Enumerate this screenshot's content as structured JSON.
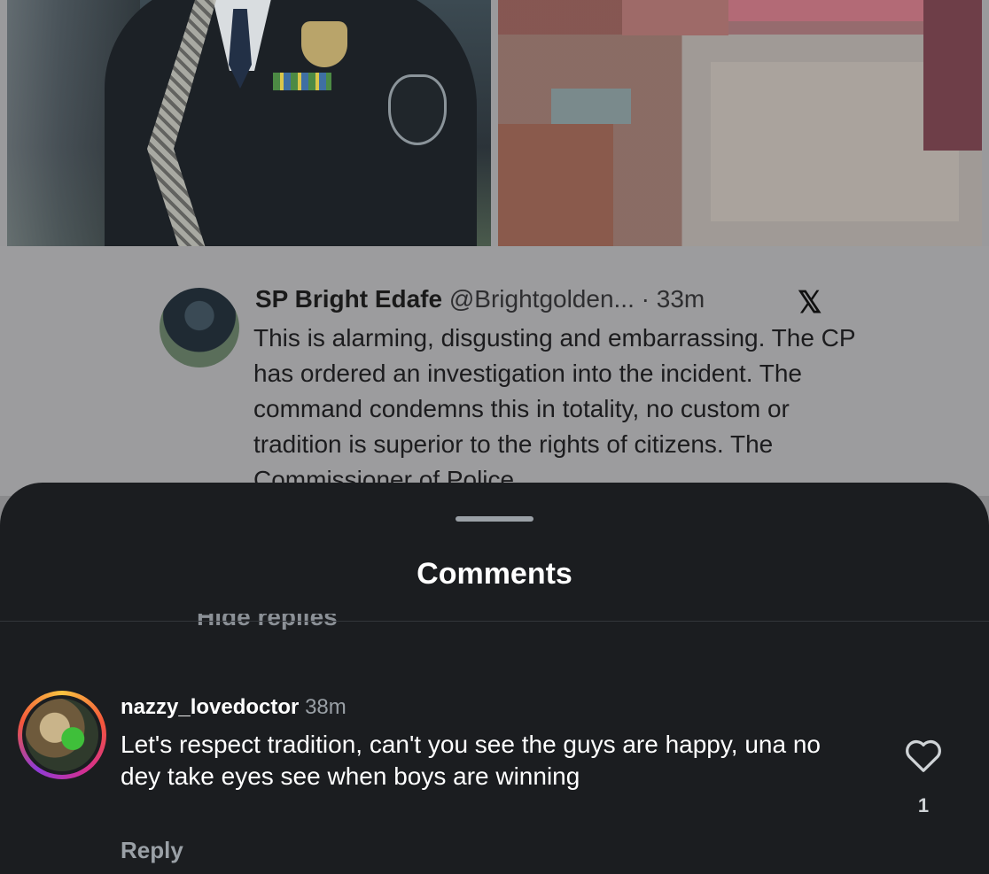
{
  "tweet": {
    "name": "SP Bright Edafe",
    "handle": "@Brightgolden...",
    "separator": " · ",
    "time": "33m",
    "brand_icon": "x-logo-icon",
    "text": "This is alarming, disgusting and embarrassing. The CP has ordered an investigation into the incident. The command condemns this in totality, no custom or tradition is superior to the rights of citizens. The Commissioner of Police"
  },
  "sheet": {
    "title": "Comments",
    "hide_replies": "Hide replies"
  },
  "comment": {
    "username": "nazzy_lovedoctor",
    "time": "38m",
    "text": "Let's respect tradition, can't you see the guys are happy, una no dey take eyes see when boys are winning",
    "reply_label": "Reply",
    "like_icon": "heart-icon",
    "like_count": "1"
  },
  "colors": {
    "sheet_bg": "#1b1d20",
    "text_primary": "#ffffff",
    "text_secondary": "#9aa0a6"
  }
}
